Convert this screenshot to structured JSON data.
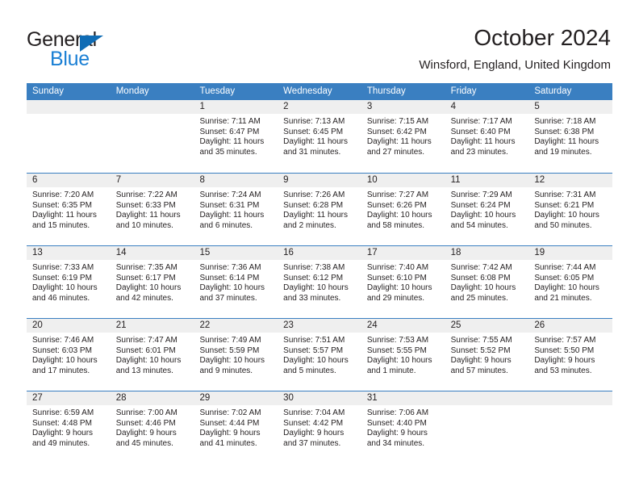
{
  "brand": {
    "name_part1": "General",
    "name_part2": "Blue",
    "accent_color": "#1a7fd4",
    "triangle_color": "#0f6cb5"
  },
  "header": {
    "title": "October 2024",
    "subtitle": "Winsford, England, United Kingdom"
  },
  "calendar": {
    "header_bg": "#3a7fc1",
    "day_band_bg": "#efefef",
    "weekdays": [
      "Sunday",
      "Monday",
      "Tuesday",
      "Wednesday",
      "Thursday",
      "Friday",
      "Saturday"
    ],
    "weeks": [
      [
        {
          "day": "",
          "lines": []
        },
        {
          "day": "",
          "lines": []
        },
        {
          "day": "1",
          "lines": [
            "Sunrise: 7:11 AM",
            "Sunset: 6:47 PM",
            "Daylight: 11 hours",
            "and 35 minutes."
          ]
        },
        {
          "day": "2",
          "lines": [
            "Sunrise: 7:13 AM",
            "Sunset: 6:45 PM",
            "Daylight: 11 hours",
            "and 31 minutes."
          ]
        },
        {
          "day": "3",
          "lines": [
            "Sunrise: 7:15 AM",
            "Sunset: 6:42 PM",
            "Daylight: 11 hours",
            "and 27 minutes."
          ]
        },
        {
          "day": "4",
          "lines": [
            "Sunrise: 7:17 AM",
            "Sunset: 6:40 PM",
            "Daylight: 11 hours",
            "and 23 minutes."
          ]
        },
        {
          "day": "5",
          "lines": [
            "Sunrise: 7:18 AM",
            "Sunset: 6:38 PM",
            "Daylight: 11 hours",
            "and 19 minutes."
          ]
        }
      ],
      [
        {
          "day": "6",
          "lines": [
            "Sunrise: 7:20 AM",
            "Sunset: 6:35 PM",
            "Daylight: 11 hours",
            "and 15 minutes."
          ]
        },
        {
          "day": "7",
          "lines": [
            "Sunrise: 7:22 AM",
            "Sunset: 6:33 PM",
            "Daylight: 11 hours",
            "and 10 minutes."
          ]
        },
        {
          "day": "8",
          "lines": [
            "Sunrise: 7:24 AM",
            "Sunset: 6:31 PM",
            "Daylight: 11 hours",
            "and 6 minutes."
          ]
        },
        {
          "day": "9",
          "lines": [
            "Sunrise: 7:26 AM",
            "Sunset: 6:28 PM",
            "Daylight: 11 hours",
            "and 2 minutes."
          ]
        },
        {
          "day": "10",
          "lines": [
            "Sunrise: 7:27 AM",
            "Sunset: 6:26 PM",
            "Daylight: 10 hours",
            "and 58 minutes."
          ]
        },
        {
          "day": "11",
          "lines": [
            "Sunrise: 7:29 AM",
            "Sunset: 6:24 PM",
            "Daylight: 10 hours",
            "and 54 minutes."
          ]
        },
        {
          "day": "12",
          "lines": [
            "Sunrise: 7:31 AM",
            "Sunset: 6:21 PM",
            "Daylight: 10 hours",
            "and 50 minutes."
          ]
        }
      ],
      [
        {
          "day": "13",
          "lines": [
            "Sunrise: 7:33 AM",
            "Sunset: 6:19 PM",
            "Daylight: 10 hours",
            "and 46 minutes."
          ]
        },
        {
          "day": "14",
          "lines": [
            "Sunrise: 7:35 AM",
            "Sunset: 6:17 PM",
            "Daylight: 10 hours",
            "and 42 minutes."
          ]
        },
        {
          "day": "15",
          "lines": [
            "Sunrise: 7:36 AM",
            "Sunset: 6:14 PM",
            "Daylight: 10 hours",
            "and 37 minutes."
          ]
        },
        {
          "day": "16",
          "lines": [
            "Sunrise: 7:38 AM",
            "Sunset: 6:12 PM",
            "Daylight: 10 hours",
            "and 33 minutes."
          ]
        },
        {
          "day": "17",
          "lines": [
            "Sunrise: 7:40 AM",
            "Sunset: 6:10 PM",
            "Daylight: 10 hours",
            "and 29 minutes."
          ]
        },
        {
          "day": "18",
          "lines": [
            "Sunrise: 7:42 AM",
            "Sunset: 6:08 PM",
            "Daylight: 10 hours",
            "and 25 minutes."
          ]
        },
        {
          "day": "19",
          "lines": [
            "Sunrise: 7:44 AM",
            "Sunset: 6:05 PM",
            "Daylight: 10 hours",
            "and 21 minutes."
          ]
        }
      ],
      [
        {
          "day": "20",
          "lines": [
            "Sunrise: 7:46 AM",
            "Sunset: 6:03 PM",
            "Daylight: 10 hours",
            "and 17 minutes."
          ]
        },
        {
          "day": "21",
          "lines": [
            "Sunrise: 7:47 AM",
            "Sunset: 6:01 PM",
            "Daylight: 10 hours",
            "and 13 minutes."
          ]
        },
        {
          "day": "22",
          "lines": [
            "Sunrise: 7:49 AM",
            "Sunset: 5:59 PM",
            "Daylight: 10 hours",
            "and 9 minutes."
          ]
        },
        {
          "day": "23",
          "lines": [
            "Sunrise: 7:51 AM",
            "Sunset: 5:57 PM",
            "Daylight: 10 hours",
            "and 5 minutes."
          ]
        },
        {
          "day": "24",
          "lines": [
            "Sunrise: 7:53 AM",
            "Sunset: 5:55 PM",
            "Daylight: 10 hours",
            "and 1 minute."
          ]
        },
        {
          "day": "25",
          "lines": [
            "Sunrise: 7:55 AM",
            "Sunset: 5:52 PM",
            "Daylight: 9 hours",
            "and 57 minutes."
          ]
        },
        {
          "day": "26",
          "lines": [
            "Sunrise: 7:57 AM",
            "Sunset: 5:50 PM",
            "Daylight: 9 hours",
            "and 53 minutes."
          ]
        }
      ],
      [
        {
          "day": "27",
          "lines": [
            "Sunrise: 6:59 AM",
            "Sunset: 4:48 PM",
            "Daylight: 9 hours",
            "and 49 minutes."
          ]
        },
        {
          "day": "28",
          "lines": [
            "Sunrise: 7:00 AM",
            "Sunset: 4:46 PM",
            "Daylight: 9 hours",
            "and 45 minutes."
          ]
        },
        {
          "day": "29",
          "lines": [
            "Sunrise: 7:02 AM",
            "Sunset: 4:44 PM",
            "Daylight: 9 hours",
            "and 41 minutes."
          ]
        },
        {
          "day": "30",
          "lines": [
            "Sunrise: 7:04 AM",
            "Sunset: 4:42 PM",
            "Daylight: 9 hours",
            "and 37 minutes."
          ]
        },
        {
          "day": "31",
          "lines": [
            "Sunrise: 7:06 AM",
            "Sunset: 4:40 PM",
            "Daylight: 9 hours",
            "and 34 minutes."
          ]
        },
        {
          "day": "",
          "lines": []
        },
        {
          "day": "",
          "lines": []
        }
      ]
    ]
  }
}
